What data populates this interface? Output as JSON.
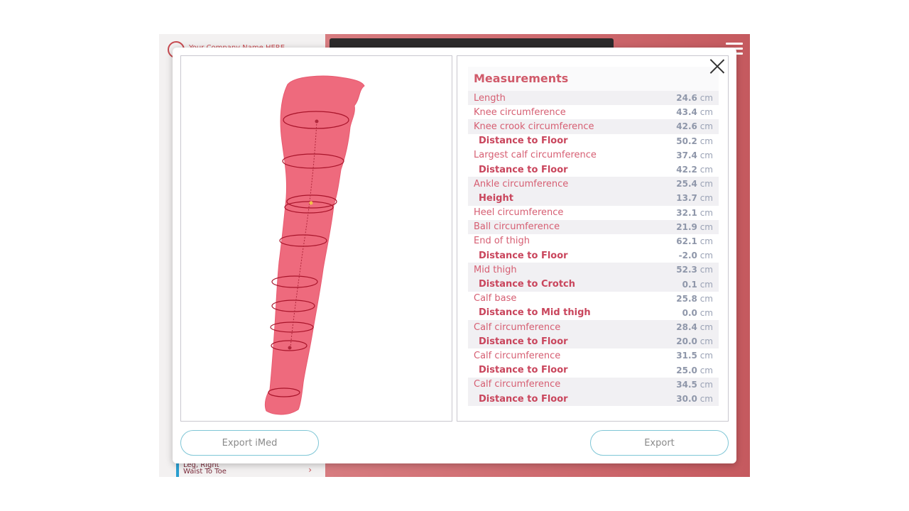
{
  "background_app": {
    "company_name": "Your Company Name HERE",
    "list_item_line1": "Leg, Right",
    "list_item_line2": "Waist To Toe"
  },
  "modal": {
    "title": "Measurements",
    "export_imed_label": "Export iMed",
    "export_label": "Export",
    "unit": "cm",
    "rows": [
      {
        "label": "Length",
        "value": "24.6",
        "sub": false
      },
      {
        "label": "Knee circumference",
        "value": "43.4",
        "sub": false
      },
      {
        "label": "Knee crook circumference",
        "value": "42.6",
        "sub": false
      },
      {
        "label": "Distance to Floor",
        "value": "50.2",
        "sub": true
      },
      {
        "label": "Largest calf circumference",
        "value": "37.4",
        "sub": false
      },
      {
        "label": "Distance to Floor",
        "value": "42.2",
        "sub": true
      },
      {
        "label": "Ankle circumference",
        "value": "25.4",
        "sub": false
      },
      {
        "label": "Height",
        "value": "13.7",
        "sub": true
      },
      {
        "label": "Heel circumference",
        "value": "32.1",
        "sub": false
      },
      {
        "label": "Ball circumference",
        "value": "21.9",
        "sub": false
      },
      {
        "label": "End of thigh",
        "value": "62.1",
        "sub": false
      },
      {
        "label": "Distance to Floor",
        "value": "-2.0",
        "sub": true
      },
      {
        "label": "Mid thigh",
        "value": "52.3",
        "sub": false
      },
      {
        "label": "Distance to Crotch",
        "value": "0.1",
        "sub": true
      },
      {
        "label": "Calf base",
        "value": "25.8",
        "sub": false
      },
      {
        "label": "Distance to Mid thigh",
        "value": "0.0",
        "sub": true
      },
      {
        "label": "Calf circumference",
        "value": "28.4",
        "sub": false
      },
      {
        "label": "Distance to Floor",
        "value": "20.0",
        "sub": true
      },
      {
        "label": "Calf circumference",
        "value": "31.5",
        "sub": false
      },
      {
        "label": "Distance to Floor",
        "value": "25.0",
        "sub": true
      },
      {
        "label": "Calf circumference",
        "value": "34.5",
        "sub": false
      },
      {
        "label": "Distance to Floor",
        "value": "30.0",
        "sub": true
      }
    ]
  },
  "colors": {
    "accent": "#d05a6a",
    "leg_fill": "#ee6a7d",
    "ring_stroke": "#a8142a",
    "button_border": "#7fc6d6"
  }
}
